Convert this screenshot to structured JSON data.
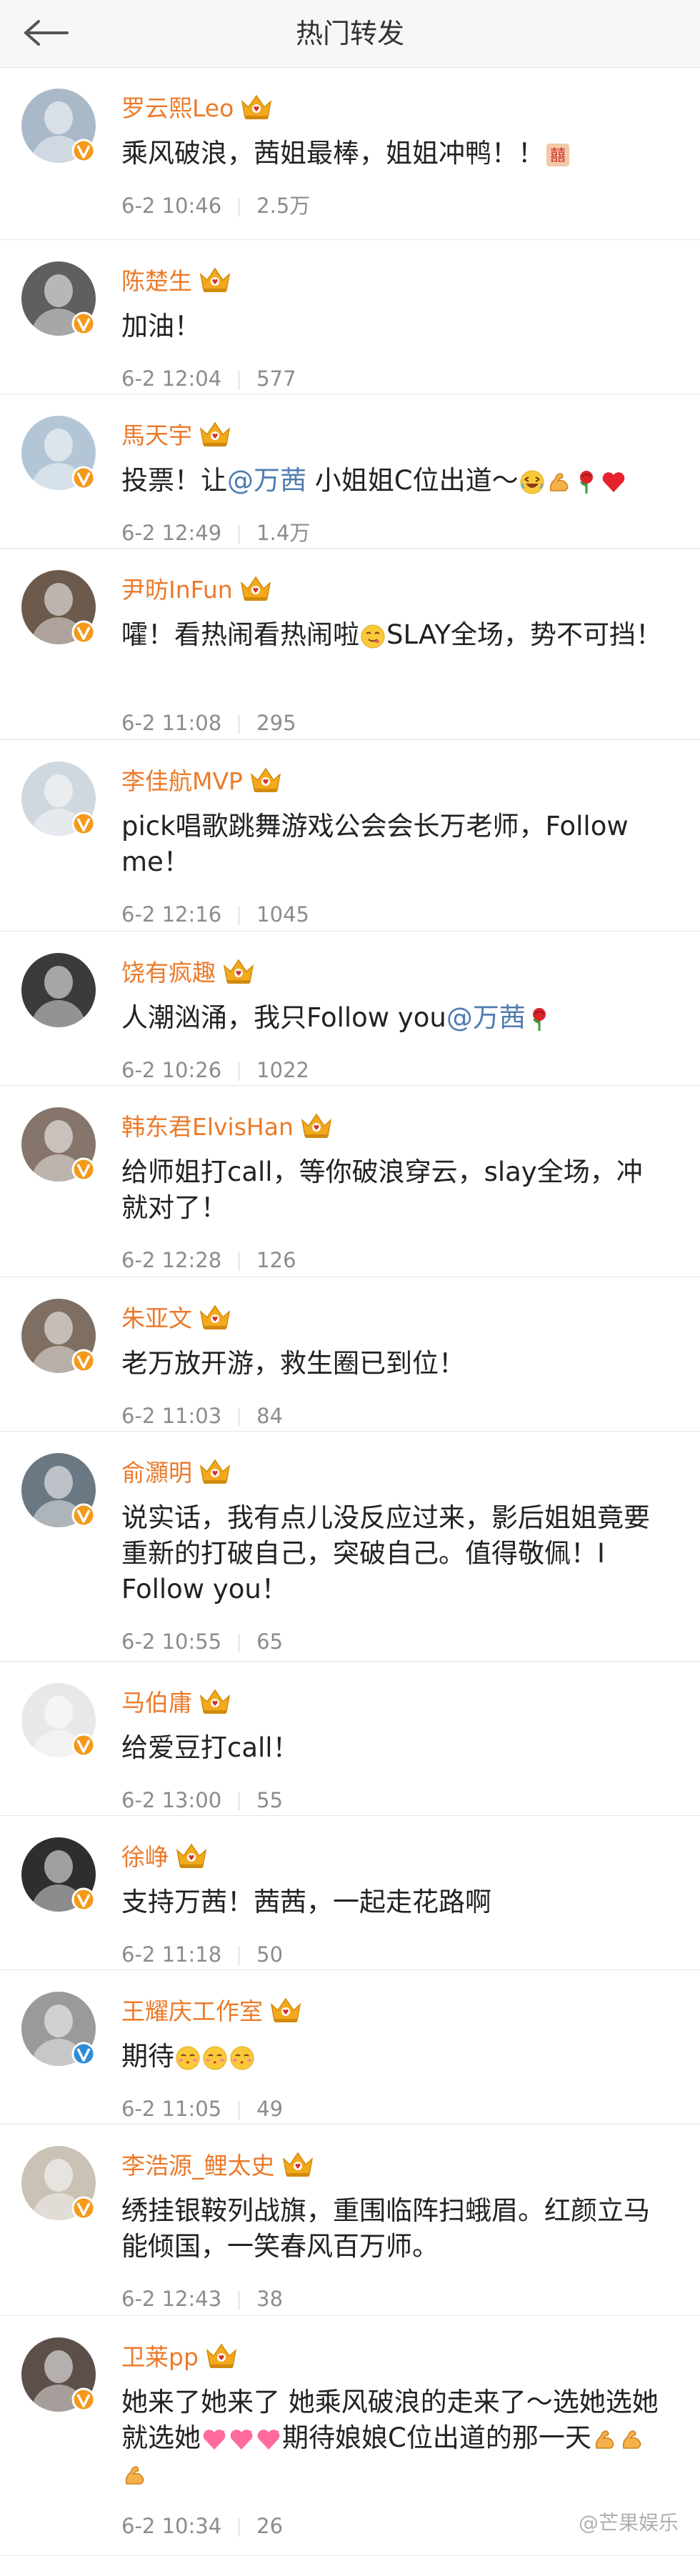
{
  "header": {
    "title": "热门转发"
  },
  "colors": {
    "name": "#eb7a2a",
    "mention": "#4f7cae",
    "badge_orange": "#f39a1b",
    "badge_blue": "#2d8dd8",
    "crown": "#f2a91b"
  },
  "comments": [
    {
      "name": "罗云熙Leo",
      "text_before": "乘风破浪，茜姐最棒，姐姐冲鸭！！",
      "mention": "",
      "text_after": "",
      "emojis": [
        "sticker"
      ],
      "time": "6-2 10:46",
      "reposts": "2.5万",
      "badge": "orange"
    },
    {
      "name": "陈楚生",
      "text_before": "加油！",
      "mention": "",
      "text_after": "",
      "emojis": [],
      "time": "6-2 12:04",
      "reposts": "577",
      "badge": "orange"
    },
    {
      "name": "馬天宇",
      "text_before": "投票！让",
      "mention": "@万茜",
      "text_after": " 小姐姐C位出道～",
      "emojis": [
        "laugh",
        "muscle",
        "rose",
        "heart"
      ],
      "time": "6-2 12:49",
      "reposts": "1.4万",
      "badge": "orange"
    },
    {
      "name": "尹昉InFun",
      "text_before": "嚯！看热闹看热闹啦",
      "mention": "",
      "text_after": "SLAY全场，势不可挡！",
      "emojis_inline": [
        "grin"
      ],
      "emojis": [],
      "time": "6-2 11:08",
      "reposts": "295",
      "badge": "orange"
    },
    {
      "name": "李佳航MVP",
      "text_before": "pick唱歌跳舞游戏公会会长万老师，Follow me！",
      "mention": "",
      "text_after": "",
      "emojis": [],
      "time": "6-2 12:16",
      "reposts": "1045",
      "badge": "orange"
    },
    {
      "name": "饶有疯趣",
      "text_before": "人潮汹涌，我只Follow you",
      "mention": "@万茜",
      "text_after": "",
      "emojis": [
        "rose"
      ],
      "time": "6-2 10:26",
      "reposts": "1022",
      "badge": "none"
    },
    {
      "name": "韩东君ElvisHan",
      "text_before": "给师姐打call，等你破浪穿云，slay全场，冲就对了！",
      "mention": "",
      "text_after": "",
      "emojis": [],
      "time": "6-2 12:28",
      "reposts": "126",
      "badge": "orange"
    },
    {
      "name": "朱亚文",
      "text_before": "老万放开游，救生圈已到位！",
      "mention": "",
      "text_after": "",
      "emojis": [],
      "time": "6-2 11:03",
      "reposts": "84",
      "badge": "orange"
    },
    {
      "name": "俞灝明",
      "text_before": "说实话，我有点儿没反应过来，影后姐姐竟要重新的打破自己，突破自己。值得敬佩！I Follow you！",
      "mention": "",
      "text_after": "",
      "emojis": [],
      "time": "6-2 10:55",
      "reposts": "65",
      "badge": "orange"
    },
    {
      "name": "马伯庸",
      "text_before": "给爱豆打call！",
      "mention": "",
      "text_after": "",
      "emojis": [],
      "time": "6-2 13:00",
      "reposts": "55",
      "badge": "orange"
    },
    {
      "name": "徐峥",
      "text_before": "支持万茜！茜茜，一起走花路啊",
      "mention": "",
      "text_after": "",
      "emojis": [],
      "time": "6-2 11:18",
      "reposts": "50",
      "badge": "orange"
    },
    {
      "name": "王耀庆工作室",
      "text_before": "期待",
      "mention": "",
      "text_after": "",
      "emojis": [
        "kiss",
        "kiss",
        "kiss"
      ],
      "time": "6-2 11:05",
      "reposts": "49",
      "badge": "blue"
    },
    {
      "name": "李浩源_鲤太史",
      "text_before": "绣挂银鞍列战旗，重围临阵扫蛾眉。红颜立马能倾国，一笑春风百万师。",
      "mention": "",
      "text_after": "",
      "emojis": [],
      "time": "6-2 12:43",
      "reposts": "38",
      "badge": "orange"
    },
    {
      "name": "卫莱pp",
      "text_before": "她来了她来了 她乘风破浪的走来了～选她选她就选她",
      "mention": "",
      "text_after": "期待娘娘C位出道的那一天",
      "emojis_inline": [
        "hearts",
        "hearts",
        "hearts"
      ],
      "emojis": [
        "muscle",
        "muscle",
        "muscle"
      ],
      "time": "6-2 10:34",
      "reposts": "26",
      "badge": "orange"
    }
  ],
  "watermark": "@芒果娱乐"
}
